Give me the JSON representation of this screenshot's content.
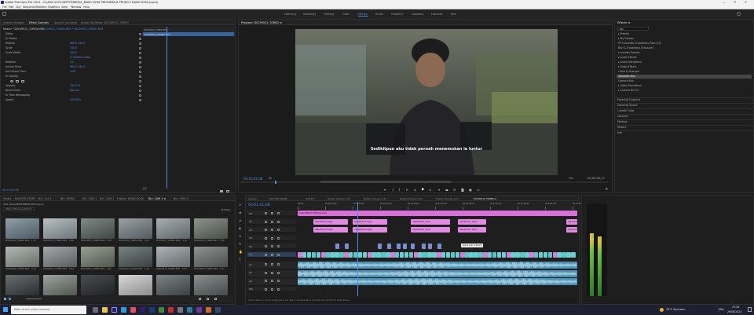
{
  "titlebar": {
    "title": "Adobe Premiere Pro 2021 - D:\\ADS 2022\\SEPTEMBER\\X_BANG DODI PREMIERE\\X PROJECT BANG DODI.prproj",
    "minimize": "—",
    "maximize": "☐",
    "close": "✕"
  },
  "menubar": [
    "File",
    "Edit",
    "Clip",
    "Sequence",
    "Markers",
    "Graphics",
    "View",
    "Window",
    "Help"
  ],
  "workspaces": [
    "Learning",
    "Assembly",
    "Editing",
    "Color",
    "Effects",
    "Audio",
    "Graphics",
    "Captions",
    "Libraries",
    "Bub"
  ],
  "active_workspace": "Effects",
  "effect_controls": {
    "tabs": [
      "Lumetri Scopes",
      "Effect Controls",
      "Source: (no clips)",
      "Audio Clip Mixer: DSC09512_TOREO"
    ],
    "active_tab": "Effect Controls",
    "master": "Master * DSC09512_TORED.MP4",
    "sequence": "DSC09512_TORED.MP4 • DSC09512_TORED.MP4",
    "rows": [
      {
        "label": "Video",
        "value": ""
      },
      {
        "label": "fx  Motion",
        "value": ""
      },
      {
        "label": "Position",
        "value": "960.0   540.0"
      },
      {
        "label": "Scale",
        "value": "100.0"
      },
      {
        "label": "Scale Width",
        "value": "100.0"
      },
      {
        "label": "",
        "value": "☑ Uniform Scale"
      },
      {
        "label": "Rotation",
        "value": "0.0"
      },
      {
        "label": "Anchor Point",
        "value": "960.0   540.0"
      },
      {
        "label": "Anti-flicker Filter",
        "value": "0.00"
      },
      {
        "label": "fx  Opacity",
        "value": ""
      },
      {
        "label": "",
        "value": ""
      },
      {
        "label": "Opacity",
        "value": "100.0 %"
      },
      {
        "label": "Blend Mode",
        "value": "Normal"
      },
      {
        "label": "fx  Time Remapping",
        "value": ""
      },
      {
        "label": "Speed",
        "value": "100.00%"
      }
    ],
    "clip_tag_1": "DSC09512_TORED.MP4",
    "clip_tag_2": "DSC09512_TORED.MP4",
    "timecode": "00;01;01;08"
  },
  "program": {
    "title": "Program: DSC09512_TORED ≡",
    "subtitle": "Sedikitpun aku tidak pernah menemukan la luntur",
    "timecode": "00;01;01;08",
    "fit": "Fit",
    "quality": "Full",
    "duration": "00;00;00;17"
  },
  "effects": {
    "title": "Effects ≡",
    "search": "blur",
    "items": [
      "▸ Presets",
      "▸ My Presets",
      "  PP Cinematic Transitions Pack (12)",
      "    Blur & Transitions (Dissolve)",
      "▸ Lumetri Presets",
      "▸ Audio Effects",
      "▸ Audio Transitions",
      "▾ Video Effects",
      "  ▾ Blur & Sharpen",
      "      Gaussian Blur",
      "      Camera Blur",
      "▸ Video Transitions",
      "▸ Custom Bin 01"
    ],
    "selected_index": 9,
    "sections": [
      "Essential Graphics",
      "Essential Sound",
      "Lumetri Color",
      "Libraries",
      "Markers",
      "History",
      "Info"
    ]
  },
  "project": {
    "path": "ADS 2022\\SEPTEMBER\\TEST.prproj",
    "tabs": [
      "Media",
      "MASTER STORY",
      "Bin: Cut 1",
      "Bin: MUSIC",
      "Bin: CAM 2",
      "Bin: CAM 1",
      "Project: BANG DODI",
      "Bin: CAM 1 ≡",
      "Bin: CAM 3"
    ],
    "active_tab": "Bin: CAM 1 ≡",
    "bin_path": "BANG DODI/project/CAM 1",
    "count": "75 items",
    "clips": [
      {
        "name": "DSC09512_TORED.MP4",
        "dur": "1;17",
        "c1": "#8ea0a8",
        "c2": "#4d5a62"
      },
      {
        "name": "DSC09513_TORED.MP4",
        "dur": "4;28",
        "c1": "#b8c0c2",
        "c2": "#6a7478"
      },
      {
        "name": "DSC09515_TORED.MP4",
        "dur": "6;10",
        "c1": "#7f8a86",
        "c2": "#3e4644"
      },
      {
        "name": "DSC09516_TORED.MP4",
        "dur": "2;02",
        "c1": "#9aa2a6",
        "c2": "#515a5e"
      },
      {
        "name": "DSC09517_TORED.MP4",
        "dur": "3;12",
        "c1": "#a6aeb0",
        "c2": "#5e6568"
      },
      {
        "name": "DSC09519_TORED.MP4",
        "dur": "5;06",
        "c1": "#8c948c",
        "c2": "#474e48"
      },
      {
        "name": "DSC09520_TORED.MP4",
        "dur": "2;19",
        "c1": "#b2b8b4",
        "c2": "#666c68"
      },
      {
        "name": "DSC09521_TORED.MP4",
        "dur": "3;24",
        "c1": "#a4a8a8",
        "c2": "#585c5e"
      },
      {
        "name": "DSC09522_TORED.MP4",
        "dur": "4;01",
        "c1": "#98a096",
        "c2": "#4f574c"
      },
      {
        "name": "DSC09524_TORED.MP4",
        "dur": "1;28",
        "c1": "#7a8284",
        "c2": "#3a4042"
      },
      {
        "name": "DSC09525_TORED.MP4",
        "dur": "6;02",
        "c1": "#b0b4b8",
        "c2": "#62686c"
      },
      {
        "name": "DSC09526_TORED.MP4",
        "dur": "2;11",
        "c1": "#8e9492",
        "c2": "#4a4f4e"
      },
      {
        "name": "DSC09527_TORED.MP4",
        "dur": "",
        "c1": "#6a6e70",
        "c2": "#2a2d2e"
      },
      {
        "name": "DSC09528_TORED.MP4",
        "dur": "",
        "c1": "#9ca2a0",
        "c2": "#50564f"
      },
      {
        "name": "DSC09529_TORED.MP4",
        "dur": "",
        "c1": "#4a4e50",
        "c2": "#202224"
      },
      {
        "name": "DSC09530_TORED.MP4",
        "dur": "",
        "c1": "#d8d8d8",
        "c2": "#8c8c8c"
      },
      {
        "name": "DSC09531_TORED.MP4",
        "dur": "",
        "c1": "#7c8486",
        "c2": "#3a4042"
      },
      {
        "name": "DSC09532_TORED.MP4",
        "dur": "",
        "c1": "#8a9090",
        "c2": "#44494a"
      }
    ]
  },
  "timeline": {
    "tabs": [
      "Jukebox",
      "MASTER ONLINE",
      "NPSLEO",
      "Nested Sequence 06",
      "Nested Sequence 01",
      "Nested Sequence 02",
      "Nested Sequence 03",
      "DSC09512_TORED ≡"
    ],
    "active_tab": "DSC09512_TORED ≡",
    "timecode": "00;01;01;08",
    "ruler": [
      "00;00",
      "00;00;16;00",
      "00;00;32;00",
      "00;00;48;00",
      "00;01;04;00",
      "00;01;20;00",
      "00;01;36;00",
      "00;01;52;00",
      "00;02;08;00",
      "00;02;24;00",
      "00;02;40;00"
    ],
    "tracks": [
      "V6",
      "V5",
      "V4",
      "V3",
      "V2",
      "V1",
      "A1",
      "A2",
      "A3",
      "Mix"
    ],
    "title_clip": "Grandfather TVI Bang Dodi",
    "adjust_label": "Adjustment Layer",
    "tooltip": "Show Out: 0;00:22",
    "status": "Click to select, or click in empty space and drag to marquee select. Use Shift, Alt, and Ctrl for other options."
  },
  "taskbar": {
    "search": "Ketik di sini untuk mencari",
    "weather": "29°C  Berawan",
    "lang": "ENG",
    "time": "23:48",
    "date": "26/08/2022"
  }
}
